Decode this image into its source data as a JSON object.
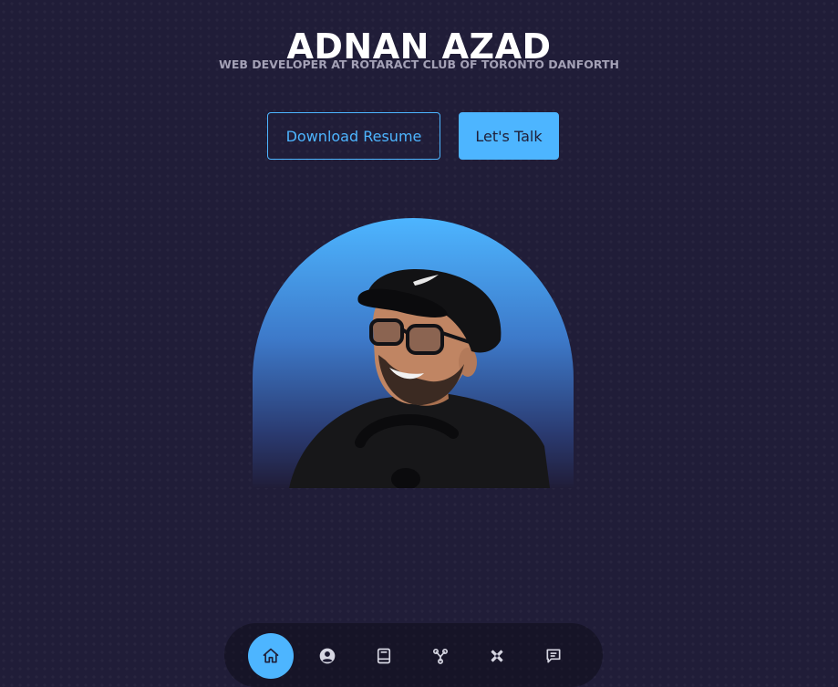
{
  "hero": {
    "name": "ADNAN AZAD",
    "subtitle": "WEB DEVELOPER AT ROTARACT CLUB OF TORONTO DANFORTH"
  },
  "cta": {
    "download_resume_label": "Download Resume",
    "lets_talk_label": "Let's Talk"
  },
  "nav": {
    "items": [
      {
        "icon": "home-icon",
        "active": true
      },
      {
        "icon": "user-icon",
        "active": false
      },
      {
        "icon": "book-icon",
        "active": false
      },
      {
        "icon": "network-icon",
        "active": false
      },
      {
        "icon": "tools-icon",
        "active": false
      },
      {
        "icon": "message-icon",
        "active": false
      }
    ]
  },
  "colors": {
    "background": "#201d38",
    "accent": "#4db5ff",
    "heading": "#ffffff",
    "subtitle": "#a4a1b6"
  }
}
